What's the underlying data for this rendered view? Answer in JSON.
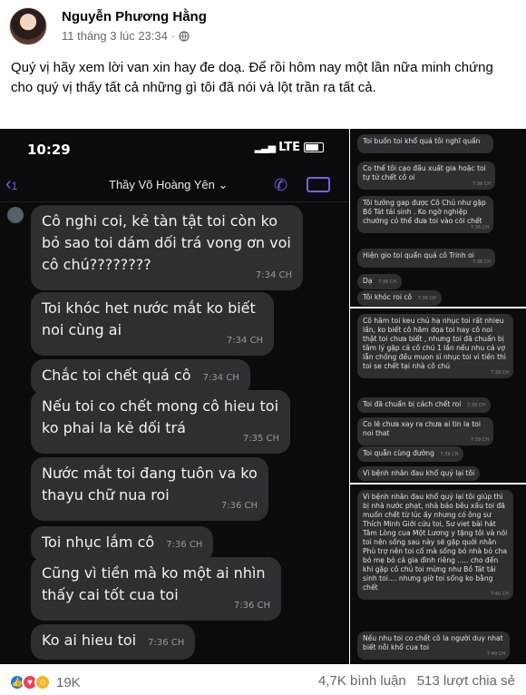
{
  "post": {
    "author": "Nguyễn Phương Hằng",
    "timestamp": "11 tháng 3 lúc 23:34",
    "separator": "·",
    "text": "Quý vị hãy xem lời van xin hay đe doạ. Để rồi hôm nay một lần nữa minh chứng cho quý vị thấy tất cả những gì tôi đã nói và lột trần ra tất cả."
  },
  "phone": {
    "time": "10:29",
    "network": "LTE",
    "contact": "Thầy Võ Hoàng Yên ⌄",
    "back": "‹",
    "back_count": "1",
    "messages": [
      {
        "text": "Cô nghi coi, kẻ tàn tật toi còn ko bỏ sao toi dám dối trá vong ơn voi cô chú????????",
        "time": "7:34 CH"
      },
      {
        "text": "Toi khóc het nước mắt ko biết noi cùng ai",
        "time": "7:34 CH"
      },
      {
        "text": "Chắc toi chết quá cô",
        "time": "7:34 CH"
      },
      {
        "text": "Nếu toi co chết mong cô hieu toi ko phai la kẻ dối trá",
        "time": "7:35 CH"
      },
      {
        "text": "Nước mắt toi đang tuôn va ko thayu chữ nua roi",
        "time": "7:36 CH"
      },
      {
        "text": "Toi nhục lắm cô",
        "time": "7:36 CH"
      },
      {
        "text": "Cũng vì tiền mà ko một ai nhìn thấy cai tốt cua toi",
        "time": "7:36 CH"
      },
      {
        "text": "Ko ai hieu toi",
        "time": "7:36 CH"
      }
    ]
  },
  "side_panels": [
    {
      "messages": [
        {
          "text": "Toi buồn toi khổ quá tôi nghĩ quẩn",
          "time": ""
        },
        {
          "text": "Co thể tôi cạo đầu xuất gia hoặc toi tự tử chết cô oi",
          "time": "7:36 CH"
        },
        {
          "text": "Tôi tưởng gap được Cô Chú như gặp Bồ Tát tái sinh . Ko ngờ nghiệp chướng có thể đưa toi vào cõi chết",
          "time": "7:36 CH"
        },
        {
          "text": "Hiện gio toi quẩn quá cô Trinh oi",
          "time": "7:36 CH"
        },
        {
          "text": "Dạ",
          "time": "7:36 CH"
        },
        {
          "text": "Tôi khóc roi cô",
          "time": "7:36 CH"
        }
      ]
    },
    {
      "messages": [
        {
          "text": "Cô hãm toi keu chú hạ nhục toi rất nhieu lần, ko biết cô hãm dọa toi hay cô noi thật toi chưa biết , nhưng toi đã chuẩn bị tâm lý gặp cả cô chú 1 lần nếu nhu cả vợ lẫn chồng đều muon sỉ nhục toi vì tiền thì toi se chết tại nhà cô chú",
          "time": "7:39 CH"
        },
        {
          "text": "Toi đã chuẩn bị cách chết roi",
          "time": "7:39 CH"
        },
        {
          "text": "Co lẽ chưa xay ra chưa ai tin la toi noi that",
          "time": "7:39 CH"
        },
        {
          "text": "Toi quẫn cùng đường",
          "time": "7:39 CH"
        },
        {
          "text": "Vì bệnh nhân đau khổ quý lại tôi",
          "time": ""
        }
      ]
    },
    {
      "messages": [
        {
          "text": "Vì bệnh nhân đau khổ quý lại tôi giúp thì bị nhà nước phạt, nhà báo bêu xấu toi đã muốn chết từ lúc ấy nhưng có ông sư Thích Minh Giới cứu toi, Sư viet bài hát Tâm Lòng cua Một Lương y tặng tôi và nói toi nên sống sau này sẽ gặp quới nhân Phù trợ nên toi cố mà sống bỏ nhà bỏ cha bỏ mẹ bỏ cả gia đình riêng ..... cho đến khi gặp cô chú toi mừng như Bồ Tát tái sinh toi.... nhưng giờ toi sống ko bằng chết",
          "time": "7:40 CH"
        },
        {
          "text": "Nếu nhu toi co chết cô la người duy nhat biết nỗi khổ cua toi",
          "time": "7:40 CH"
        }
      ]
    }
  ],
  "footer": {
    "reaction_count": "19K",
    "comments": "4,7K bình luận",
    "shares": "513 lượt chia sẻ"
  },
  "icons": {
    "reactions": [
      "like-icon",
      "love-icon",
      "haha-icon"
    ],
    "globe": "globe-icon"
  },
  "colors": {
    "accent": "#7b5cf0",
    "like": "#1877f2",
    "love": "#f33e58",
    "haha": "#f7b125"
  }
}
